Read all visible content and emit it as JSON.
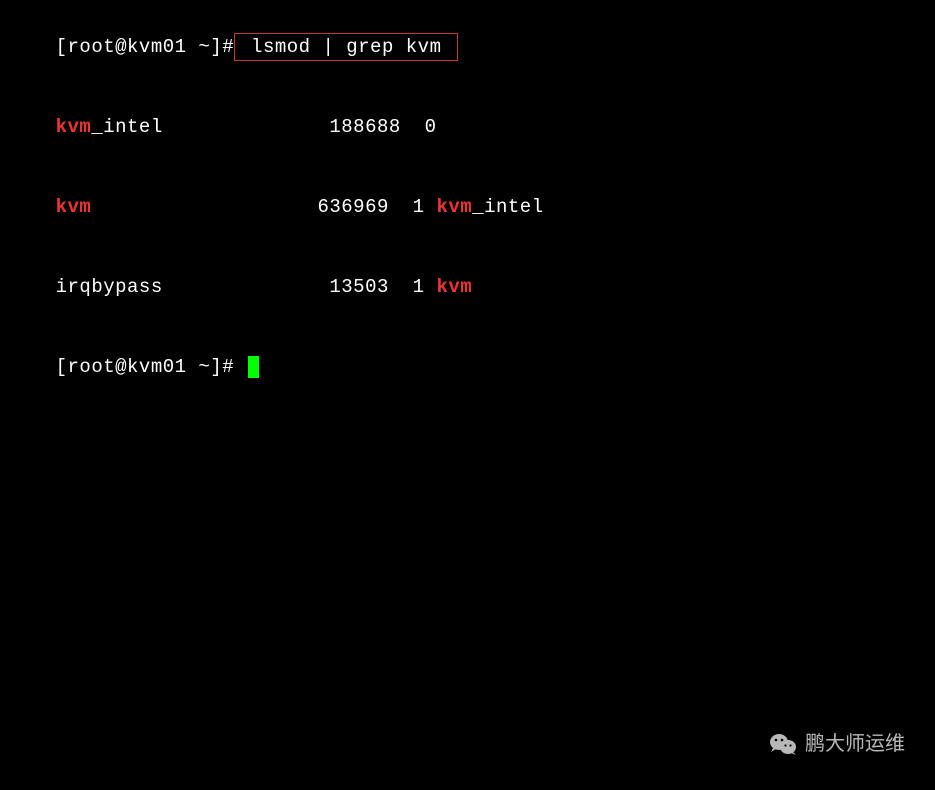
{
  "lines": {
    "line1": {
      "prompt": "[root@kvm01 ~]#",
      "command": " lsmod | grep kvm "
    },
    "line2": {
      "col1_hl": "kvm",
      "col1_rest": "_intel",
      "col2": "              188688  0",
      "col3_hl": "",
      "col3_rest": ""
    },
    "line3": {
      "col1_hl": "kvm",
      "col1_rest": "",
      "col2": "                   636969  1 ",
      "col3_hl": "kvm",
      "col3_rest": "_intel"
    },
    "line4": {
      "col1_hl": "",
      "col1_rest": "irqbypass",
      "col2": "              13503  1 ",
      "col3_hl": "kvm",
      "col3_rest": ""
    },
    "line5": {
      "prompt": "[root@kvm01 ~]# "
    }
  },
  "watermark": {
    "text": "鹏大师运维"
  }
}
